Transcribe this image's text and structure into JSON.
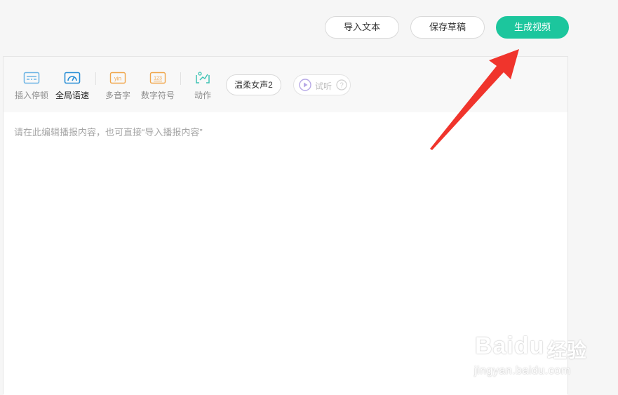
{
  "header": {
    "import_label": "导入文本",
    "save_label": "保存草稿",
    "generate_label": "生成视频"
  },
  "toolbar": {
    "tools": [
      {
        "label": "插入停顿",
        "icon": "pause-insert-icon"
      },
      {
        "label": "全局语速",
        "icon": "speedometer-icon",
        "active": true
      },
      {
        "label": "多音字",
        "icon": "pinyin-icon",
        "icon_text": "yin"
      },
      {
        "label": "数字符号",
        "icon": "number-icon",
        "icon_text": "123"
      },
      {
        "label": "动作",
        "icon": "action-icon"
      }
    ],
    "voice": "温柔女声2",
    "listen_label": "试听"
  },
  "editor": {
    "placeholder": "请在此编辑播报内容，也可直接“导入播报内容”",
    "value": ""
  },
  "watermark": {
    "logo": "Baidu",
    "brand_cn": "经验",
    "url": "jingyan.baidu.com"
  },
  "colors": {
    "primary": "#1cc69d",
    "accent_blue": "#2a8fd6",
    "accent_orange": "#f0a54a",
    "accent_teal": "#3fc3b4",
    "arrow_red": "#f0342c"
  }
}
